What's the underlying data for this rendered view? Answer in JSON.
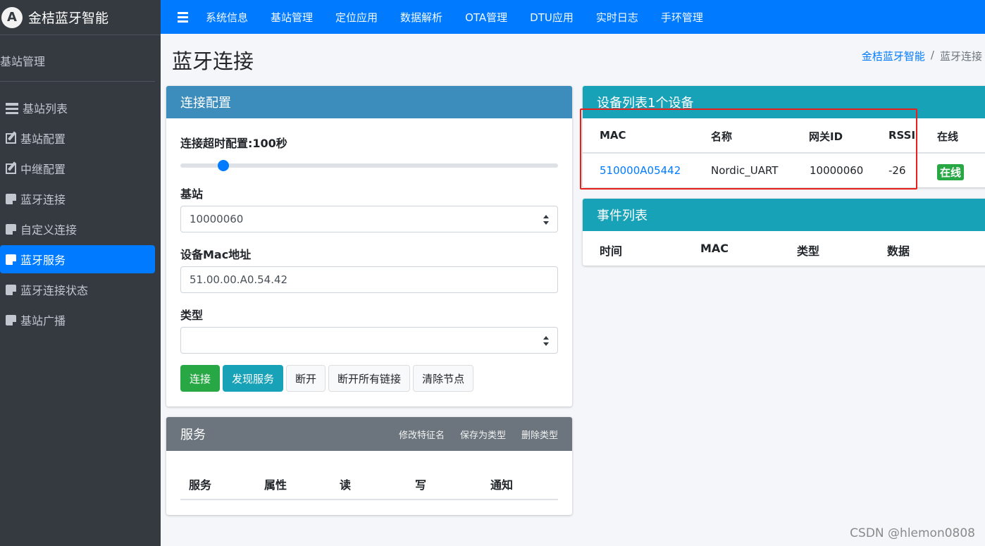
{
  "brand": {
    "logo_letter": "A",
    "name": "金桔蓝牙智能"
  },
  "sidebar": {
    "section_title": "基站管理",
    "items": [
      {
        "label": "基站列表",
        "icon": "list-icon"
      },
      {
        "label": "基站配置",
        "icon": "edit-icon"
      },
      {
        "label": "中继配置",
        "icon": "edit-icon"
      },
      {
        "label": "蓝牙连接",
        "icon": "note-icon"
      },
      {
        "label": "自定义连接",
        "icon": "note-icon"
      },
      {
        "label": "蓝牙服务",
        "icon": "note-icon",
        "active": true
      },
      {
        "label": "蓝牙连接状态",
        "icon": "note-icon"
      },
      {
        "label": "基站广播",
        "icon": "note-icon"
      }
    ]
  },
  "topnav": [
    "系统信息",
    "基站管理",
    "定位应用",
    "数据解析",
    "OTA管理",
    "DTU应用",
    "实时日志",
    "手环管理"
  ],
  "page": {
    "title": "蓝牙连接",
    "breadcrumb": {
      "home": "金桔蓝牙智能",
      "separator": "/",
      "current": "蓝牙连接"
    }
  },
  "config": {
    "header": "连接配置",
    "timeout_label": "连接超时配置:100秒",
    "timeout_fraction": 0.1,
    "station_label": "基站",
    "station_value": "10000060",
    "mac_label": "设备Mac地址",
    "mac_value": "51.00.00.A0.54.42",
    "type_label": "类型",
    "type_value": "",
    "buttons": {
      "connect": "连接",
      "discover": "发现服务",
      "disconnect": "断开",
      "disconnect_all": "断开所有链接",
      "clear": "清除节点"
    }
  },
  "service": {
    "header": "服务",
    "tools": {
      "rename": "修改特征名",
      "save_type": "保存为类型",
      "delete_type": "删除类型"
    },
    "columns": [
      "服务",
      "属性",
      "读",
      "写",
      "通知"
    ]
  },
  "devices": {
    "header": "设备列表1个设备",
    "columns": [
      "MAC",
      "名称",
      "网关ID",
      "RSSI",
      "在线"
    ],
    "rows": [
      {
        "mac": "510000A05442",
        "name": "Nordic_UART",
        "gateway": "10000060",
        "rssi": "-26",
        "status": "在线"
      }
    ]
  },
  "events": {
    "header": "事件列表",
    "columns": [
      "时间",
      "MAC",
      "类型",
      "数据"
    ]
  },
  "watermark": "CSDN @hlemon0808",
  "colors": {
    "primary": "#007bff",
    "sidebar": "#343a40",
    "success": "#28a745",
    "info": "#17a2b8",
    "highlight": "#e8201c"
  }
}
